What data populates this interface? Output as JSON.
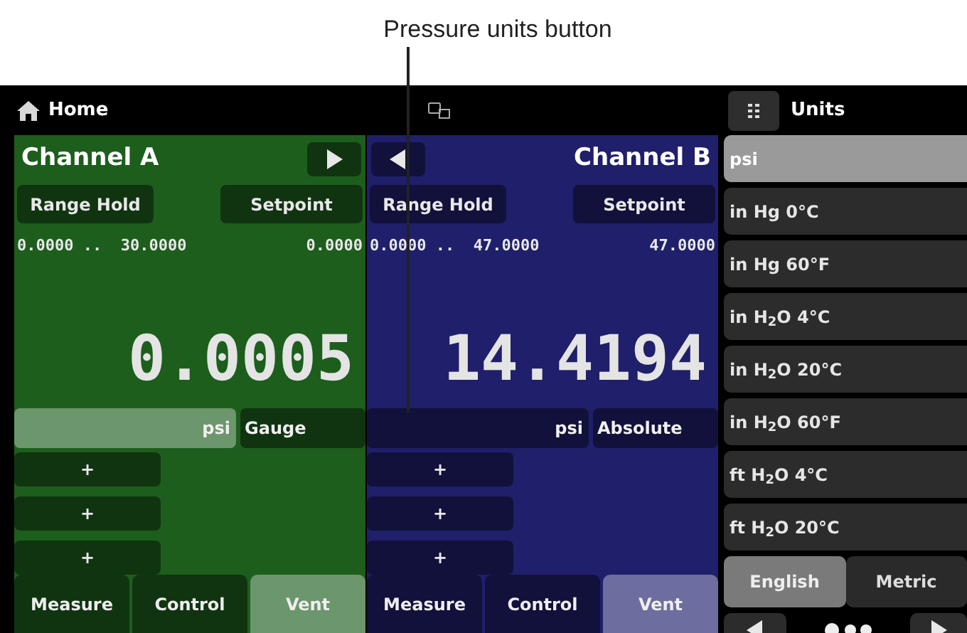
{
  "callout": {
    "label": "Pressure units button"
  },
  "header": {
    "home": "Home",
    "units_button": "Units"
  },
  "channels": [
    {
      "name": "Channel A",
      "switch_on_left": false,
      "color": "#1d5e1d",
      "range_hold": "Range Hold",
      "setpoint": "Setpoint",
      "range": "0.0000 ..  30.0000",
      "setpoint_value": "0.0000",
      "value": "0.0005",
      "unit": "psi",
      "unit_selected": true,
      "mode": "Gauge",
      "presets": [
        "+",
        "+",
        "+"
      ],
      "tabs": [
        {
          "label": "Measure",
          "selected": false
        },
        {
          "label": "Control",
          "selected": false
        },
        {
          "label": "Vent",
          "selected": true
        }
      ]
    },
    {
      "name": "Channel B",
      "switch_on_left": true,
      "color": "#1f1f6b",
      "range_hold": "Range Hold",
      "setpoint": "Setpoint",
      "range": "0.0000 ..  47.0000",
      "setpoint_value": "47.0000",
      "value": "14.4194",
      "unit": "psi",
      "unit_selected": false,
      "mode": "Absolute",
      "presets": [
        "+",
        "+",
        "+"
      ],
      "tabs": [
        {
          "label": "Measure",
          "selected": false
        },
        {
          "label": "Control",
          "selected": false
        },
        {
          "label": "Vent",
          "selected": true
        }
      ]
    }
  ],
  "units": [
    {
      "label": "psi",
      "selected": true
    },
    {
      "label": "in Hg 0°C",
      "selected": false
    },
    {
      "label": "in Hg 60°F",
      "selected": false
    },
    {
      "label": "in H$_{2}$O 4°C",
      "selected": false
    },
    {
      "label": "in H$_{2}$O 20°C",
      "selected": false
    },
    {
      "label": "in H$_{2}$O 60°F",
      "selected": false
    },
    {
      "label": "ft H$_{2}$O 4°C",
      "selected": false
    },
    {
      "label": "ft H$_{2}$O 20°C",
      "selected": false
    }
  ],
  "unit_systems": [
    {
      "label": "English",
      "selected": true
    },
    {
      "label": "Metric",
      "selected": false
    }
  ]
}
